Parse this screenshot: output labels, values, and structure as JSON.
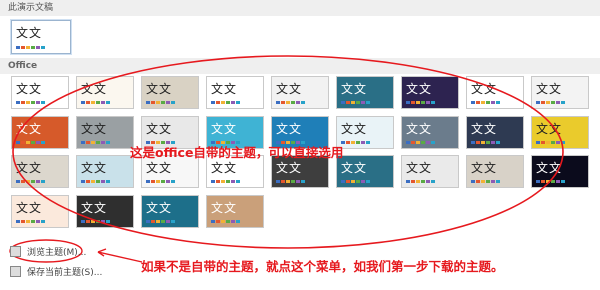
{
  "sections": {
    "this_document": "此演示文稿",
    "office": "Office"
  },
  "current_theme": {
    "text": "文文"
  },
  "themes": [
    {
      "text": "文文",
      "bg": "#ffffff",
      "fg": "#222"
    },
    {
      "text": "文文",
      "bg": "#fbf7ef",
      "fg": "#222"
    },
    {
      "text": "文文",
      "bg": "#d9d2c4",
      "fg": "#222"
    },
    {
      "text": "文文",
      "bg": "#ffffff",
      "fg": "#222"
    },
    {
      "text": "文文",
      "bg": "#f2f2f2",
      "fg": "#222"
    },
    {
      "text": "文文",
      "bg": "#2a6f86",
      "fg": "#ffffff"
    },
    {
      "text": "文文",
      "bg": "#2d2350",
      "fg": "#ffffff"
    },
    {
      "text": "文文",
      "bg": "#ffffff",
      "fg": "#222"
    },
    {
      "text": "文文",
      "bg": "#f3f3f3",
      "fg": "#222"
    },
    {
      "text": "文文",
      "bg": "#d65a2a",
      "fg": "#ffffff"
    },
    {
      "text": "文文",
      "bg": "#9aa0a3",
      "fg": "#222"
    },
    {
      "text": "文文",
      "bg": "#e8e8e8",
      "fg": "#222"
    },
    {
      "text": "文文",
      "bg": "#3fb3d4",
      "fg": "#ffffff"
    },
    {
      "text": "文文",
      "bg": "#1f7fb8",
      "fg": "#ffffff"
    },
    {
      "text": "文文",
      "bg": "#e9f3f7",
      "fg": "#222"
    },
    {
      "text": "文文",
      "bg": "#6b7c8c",
      "fg": "#ffffff"
    },
    {
      "text": "文文",
      "bg": "#2e3a52",
      "fg": "#ffffff"
    },
    {
      "text": "文文",
      "bg": "#eacb2c",
      "fg": "#222"
    },
    {
      "text": "文文",
      "bg": "#dcd7cd",
      "fg": "#222"
    },
    {
      "text": "文文",
      "bg": "#c9e1ea",
      "fg": "#222"
    },
    {
      "text": "文文",
      "bg": "#f7f7f7",
      "fg": "#222"
    },
    {
      "text": "文文",
      "bg": "#ffffff",
      "fg": "#222"
    },
    {
      "text": "文文",
      "bg": "#3e3e3e",
      "fg": "#ffffff"
    },
    {
      "text": "文文",
      "bg": "#2a6f86",
      "fg": "#ffffff"
    },
    {
      "text": "文文",
      "bg": "#eaeaea",
      "fg": "#222"
    },
    {
      "text": "文文",
      "bg": "#d8d2c8",
      "fg": "#222"
    },
    {
      "text": "文文",
      "bg": "#0b0b1c",
      "fg": "#ffffff"
    },
    {
      "text": "文文",
      "bg": "#fbe9dc",
      "fg": "#222"
    },
    {
      "text": "文文",
      "bg": "#2f2f2f",
      "fg": "#ffffff"
    },
    {
      "text": "文文",
      "bg": "#1d6f8a",
      "fg": "#ffffff"
    },
    {
      "text": "文文",
      "bg": "#caa07a",
      "fg": "#ffffff"
    }
  ],
  "palette": [
    "#3b6ec2",
    "#e4572e",
    "#f2b134",
    "#5aaa46",
    "#8d5bb5",
    "#27a2c9"
  ],
  "menu": {
    "browse": "浏览主题(M)...",
    "save": "保存当前主题(S)..."
  },
  "annotations": {
    "top": "这是office自带的主题，可以直接选用",
    "bottom": "如果不是自带的主题，就点这个菜单，如我们第一步下载的主题。"
  },
  "colors": {
    "accent": "#e6191e"
  }
}
